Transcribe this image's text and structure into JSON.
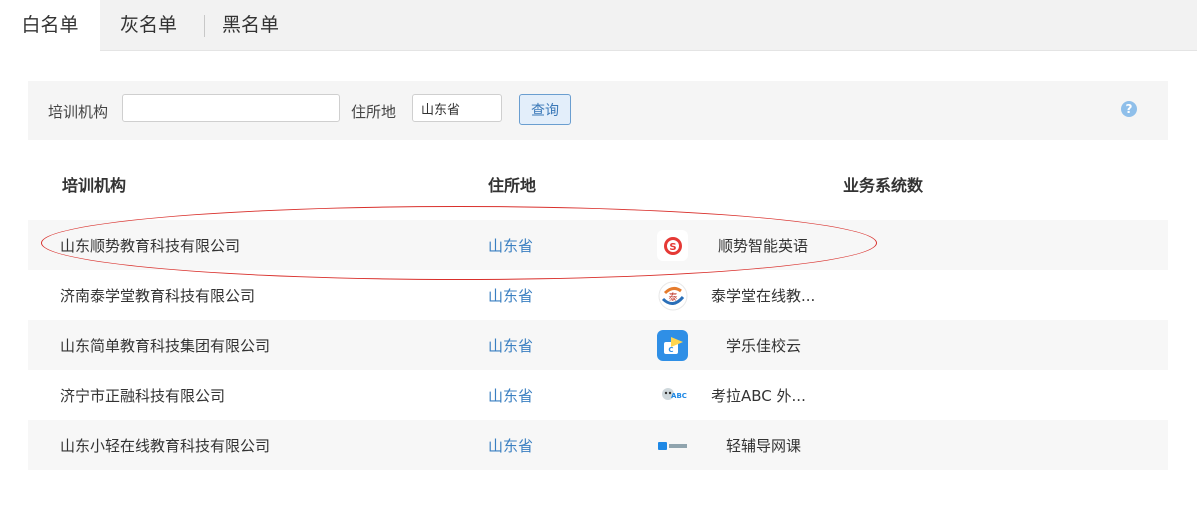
{
  "tabs": [
    {
      "label": "白名单",
      "active": true
    },
    {
      "label": "灰名单",
      "active": false
    },
    {
      "label": "黑名单",
      "active": false
    }
  ],
  "filter": {
    "org_label": "培训机构",
    "org_value": "",
    "loc_label": "住所地",
    "loc_value": "山东省",
    "query_label": "查询",
    "help_glyph": "?"
  },
  "table": {
    "headers": [
      "培训机构",
      "住所地",
      "业务系统数"
    ],
    "rows": [
      {
        "name": "山东顺势教育科技有限公司",
        "location": "山东省",
        "system": "顺势智能英语",
        "icon": "shunshi-logo-icon"
      },
      {
        "name": "济南泰学堂教育科技有限公司",
        "location": "山东省",
        "system": "泰学堂在线教...",
        "icon": "taixuetang-logo-icon"
      },
      {
        "name": "山东简单教育科技集团有限公司",
        "location": "山东省",
        "system": "学乐佳校云",
        "icon": "xuelejia-logo-icon"
      },
      {
        "name": "济宁市正融科技有限公司",
        "location": "山东省",
        "system": "考拉ABC 外...",
        "icon": "koala-abc-logo-icon"
      },
      {
        "name": "山东小轻在线教育科技有限公司",
        "location": "山东省",
        "system": "轻辅导网课",
        "icon": "qingfudao-logo-icon"
      }
    ]
  },
  "colors": {
    "link": "#3a7fc1",
    "highlight_ellipse": "#d9302c",
    "button_border": "#6a9ed0"
  }
}
